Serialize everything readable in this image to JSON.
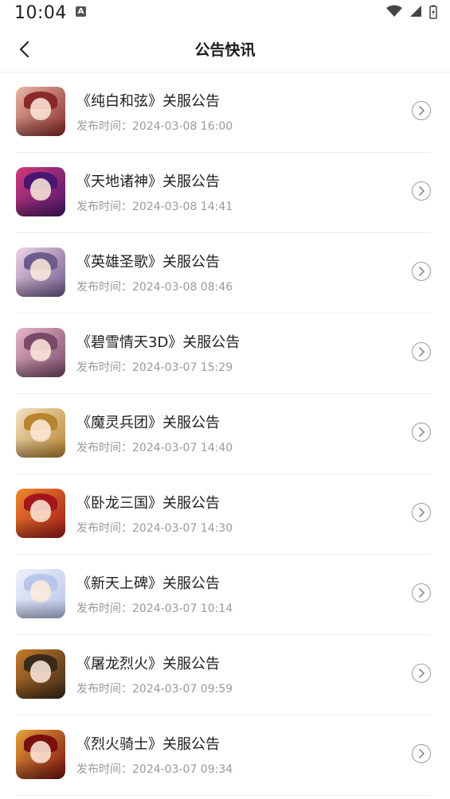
{
  "status_bar": {
    "time": "10:04",
    "indicator": "A"
  },
  "header": {
    "title": "公告快讯",
    "back_icon": "chevron-left-icon"
  },
  "items": [
    {
      "title": "《纯白和弦》关服公告",
      "time": "发布时间：2024-03-08 16:00",
      "colors": [
        "#8a2a2a",
        "#e9b7a6"
      ]
    },
    {
      "title": "《天地诸神》关服公告",
      "time": "发布时间：2024-03-08 14:41",
      "colors": [
        "#4a1670",
        "#d23a7a"
      ]
    },
    {
      "title": "《英雄圣歌》关服公告",
      "time": "发布时间：2024-03-08 08:46",
      "colors": [
        "#6e5b8e",
        "#f1d3e6"
      ]
    },
    {
      "title": "《碧雪情天3D》关服公告",
      "time": "发布时间：2024-03-07 15:29",
      "colors": [
        "#7a4a6a",
        "#e8b6c8"
      ]
    },
    {
      "title": "《魔灵兵团》关服公告",
      "time": "发布时间：2024-03-07 14:40",
      "colors": [
        "#b9842e",
        "#f2e2c2"
      ]
    },
    {
      "title": "《卧龙三国》关服公告",
      "time": "发布时间：2024-03-07 14:30",
      "colors": [
        "#a3171b",
        "#f08a2a"
      ]
    },
    {
      "title": "《新天上碑》关服公告",
      "time": "发布时间：2024-03-07 10:14",
      "colors": [
        "#b9c6ea",
        "#eef0fb"
      ]
    },
    {
      "title": "《屠龙烈火》关服公告",
      "time": "发布时间：2024-03-07 09:59",
      "colors": [
        "#3a2a1a",
        "#c87a2a"
      ]
    },
    {
      "title": "《烈火骑士》关服公告",
      "time": "发布时间：2024-03-07 09:34",
      "colors": [
        "#7a0f0f",
        "#e6a23a"
      ]
    }
  ]
}
